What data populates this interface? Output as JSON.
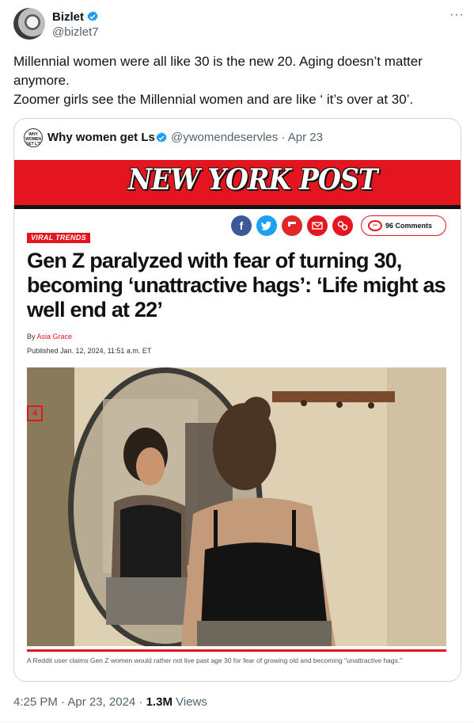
{
  "tweet": {
    "author_name": "Bizlet",
    "author_handle": "@bizlet7",
    "more_icon": "ellipsis-icon",
    "text_line1": "Millennial women were all like 30 is the new 20. Aging doesn’t matter anymore.",
    "text_line2": "Zoomer girls see the Millennial women and are like ‘ it’s over at 30’.",
    "timestamp": "4:25 PM · Apr 23, 2024 · ",
    "views_count": "1.3M",
    "views_label": " Views"
  },
  "quoted": {
    "author_name": "Why women get Ls",
    "author_handle": "@ywomendeservles · Apr 23",
    "avatar_text": "WHY WOMEN GET L'S",
    "article": {
      "brand": "NEW YORK POST",
      "tag": "VIRAL TRENDS",
      "comments_label": "96 Comments",
      "headline": "Gen Z paralyzed with fear of turning 30, becoming ‘unattractive hags’: ‘Life might as well end at 22’",
      "byline_prefix": "By ",
      "byline_author": "Asia Grace",
      "published": "Published Jan. 12, 2024, 11:51 a.m. ET",
      "photo_label": "4",
      "caption": "A Reddit user claims Gen Z women would rather not live past age 30 for fear of growing old and becoming \"unattractive hags.\""
    }
  },
  "colors": {
    "nyp_red": "#e4151f",
    "verified_blue": "#1d9bf0",
    "facebook": "#3b5998",
    "twitter": "#1da1f2",
    "flipboard": "#e12828",
    "email": "#e4151f",
    "link": "#e4151f"
  }
}
